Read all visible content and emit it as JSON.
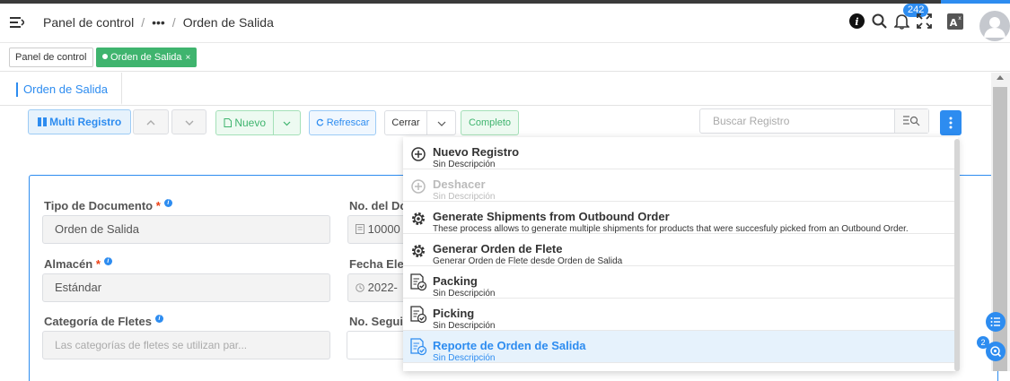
{
  "header": {
    "breadcrumb_root": "Panel de control",
    "breadcrumb_sep1": "/",
    "breadcrumb_ellipsis": "•••",
    "breadcrumb_sep2": "/",
    "breadcrumb_current": "Orden de Salida",
    "notification_count": "242"
  },
  "tags": {
    "home": "Panel de control",
    "active": "Orden de Salida",
    "close": "×"
  },
  "tab": {
    "label": "Orden de Salida"
  },
  "toolbar": {
    "multi_registro": "Multi Registro",
    "nuevo": "Nuevo",
    "refrescar": "Refrescar",
    "cerrar": "Cerrar",
    "completo": "Completo",
    "search_placeholder": "Buscar Registro"
  },
  "form": {
    "tipo_documento_label": "Tipo de Documento",
    "tipo_documento_value": "Orden de Salida",
    "no_documento_label": "No. del Do",
    "no_documento_value": "10000",
    "almacen_label": "Almacén",
    "almacen_value": "Estándar",
    "fecha_label": "Fecha Eleg",
    "fecha_value": "2022-",
    "categoria_label": "Categoría de Fletes",
    "categoria_placeholder": "Las categorías de fletes se utilizan par...",
    "no_seguimiento_label": "No. Seguir",
    "required_mark": "*",
    "info_mark": "i"
  },
  "menu": {
    "items": [
      {
        "title": "Nuevo Registro",
        "desc": "Sin Descripción"
      },
      {
        "title": "Deshacer",
        "desc": "Sin Descripción"
      },
      {
        "title": "Generate Shipments from Outbound Order",
        "desc": "These process allows to generate multiple shipments for products that were succesfuly picked from an Outbound Order."
      },
      {
        "title": "Generar Orden de Flete",
        "desc": "Generar Orden de Flete desde Orden de Salida"
      },
      {
        "title": "Packing",
        "desc": "Sin Descripción"
      },
      {
        "title": "Picking",
        "desc": "Sin Descripción"
      },
      {
        "title": "Reporte de Orden de Salida",
        "desc": "Sin Descripción"
      }
    ]
  },
  "floating": {
    "badge_count": "2"
  },
  "colors": {
    "primary": "#2d8cf0",
    "success": "#3fb46e"
  }
}
